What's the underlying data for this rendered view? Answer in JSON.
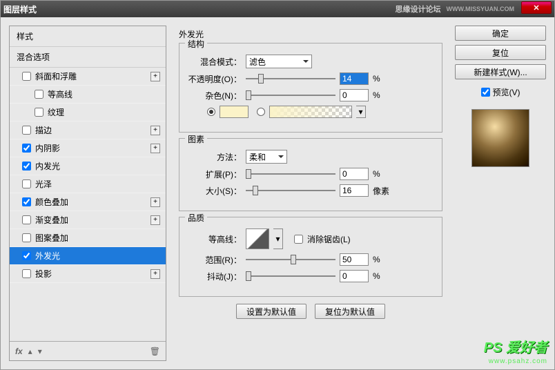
{
  "titlebar": {
    "title": "图层样式",
    "right": "思缘设计论坛",
    "url": "WWW.MISSYUAN.COM",
    "close": "✕"
  },
  "left": {
    "header1": "样式",
    "header2": "混合选项",
    "items": [
      {
        "label": "斜面和浮雕",
        "checked": false,
        "add": true,
        "sub": false
      },
      {
        "label": "等高线",
        "checked": false,
        "add": false,
        "sub": true
      },
      {
        "label": "纹理",
        "checked": false,
        "add": false,
        "sub": true
      },
      {
        "label": "描边",
        "checked": false,
        "add": true,
        "sub": false
      },
      {
        "label": "内阴影",
        "checked": true,
        "add": true,
        "sub": false
      },
      {
        "label": "内发光",
        "checked": true,
        "add": false,
        "sub": false
      },
      {
        "label": "光泽",
        "checked": false,
        "add": false,
        "sub": false
      },
      {
        "label": "颜色叠加",
        "checked": true,
        "add": true,
        "sub": false
      },
      {
        "label": "渐变叠加",
        "checked": false,
        "add": true,
        "sub": false
      },
      {
        "label": "图案叠加",
        "checked": false,
        "add": false,
        "sub": false
      },
      {
        "label": "外发光",
        "checked": true,
        "add": false,
        "sub": false,
        "selected": true
      },
      {
        "label": "投影",
        "checked": false,
        "add": true,
        "sub": false
      }
    ],
    "fx": "fx"
  },
  "center": {
    "title": "外发光",
    "structure": {
      "legend": "结构",
      "blendmode_label": "混合模式：",
      "blendmode_value": "滤色",
      "opacity_label": "不透明度(O)：",
      "opacity_value": "14",
      "opacity_unit": "%",
      "noise_label": "杂色(N)：",
      "noise_value": "0",
      "noise_unit": "%",
      "swatch_color": "#fbf3c8"
    },
    "elements": {
      "legend": "图素",
      "method_label": "方法：",
      "method_value": "柔和",
      "spread_label": "扩展(P)：",
      "spread_value": "0",
      "spread_unit": "%",
      "size_label": "大小(S)：",
      "size_value": "16",
      "size_unit": "像素"
    },
    "quality": {
      "legend": "品质",
      "contour_label": "等高线：",
      "anti_label": "消除锯齿(L)",
      "range_label": "范围(R)：",
      "range_value": "50",
      "range_unit": "%",
      "jitter_label": "抖动(J)：",
      "jitter_value": "0",
      "jitter_unit": "%"
    },
    "setdefault": "设置为默认值",
    "resetdefault": "复位为默认值"
  },
  "right": {
    "ok": "确定",
    "cancel": "复位",
    "newstyle": "新建样式(W)...",
    "preview": "预览(V)"
  },
  "watermark": {
    "brand": "PS 爱好者",
    "url": "www.psahz.com"
  }
}
